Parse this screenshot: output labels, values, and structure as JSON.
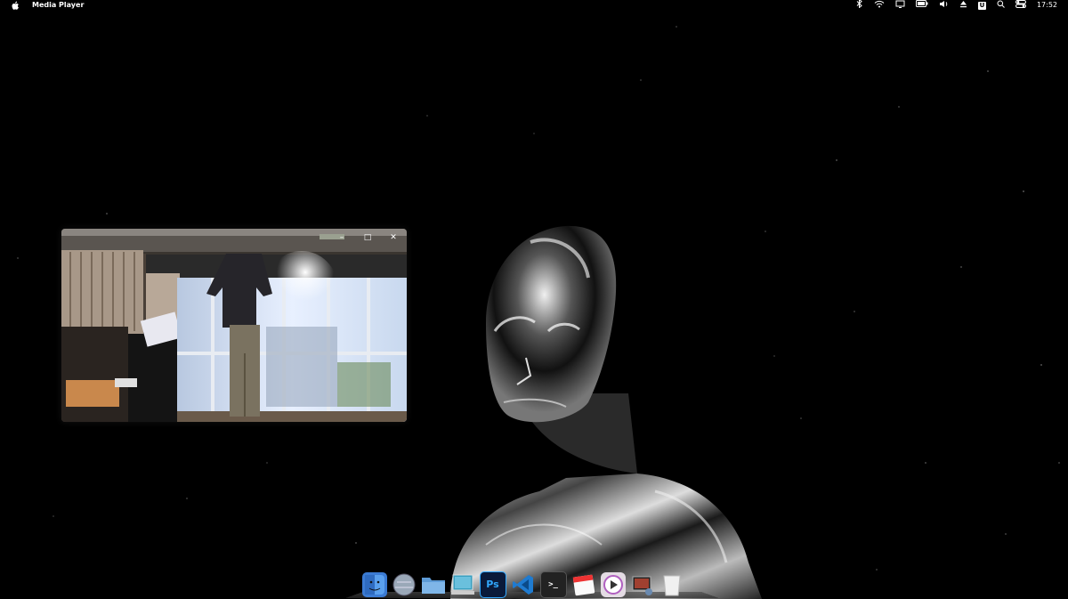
{
  "menubar": {
    "app_name": "Media Player",
    "clock": "17:52",
    "status_icons": [
      "bluetooth-icon",
      "wifi-icon",
      "display-icon",
      "battery-icon",
      "volume-icon",
      "eject-icon",
      "user-badge-icon",
      "search-icon",
      "control-center-icon"
    ],
    "user_badge": "U"
  },
  "player": {
    "controls": [
      "minimize",
      "maximize",
      "close"
    ],
    "min_glyph": "–",
    "max_glyph": "□",
    "close_glyph": "✕"
  },
  "dock": {
    "items": [
      {
        "name": "finder-icon",
        "label": "☺",
        "bg": "#3b7bd4"
      },
      {
        "name": "browser-globe-icon",
        "label": "◉",
        "bg": "#7f8fa0"
      },
      {
        "name": "folder-icon",
        "label": "",
        "bg": "#5d9bd6"
      },
      {
        "name": "preview-icon",
        "label": "",
        "bg": "#3a8fb0"
      },
      {
        "name": "photoshop-icon",
        "label": "Ps",
        "bg": "#0a1a3a"
      },
      {
        "name": "vscode-icon",
        "label": "⟨⟩",
        "bg": "#1f7bd0"
      },
      {
        "name": "terminal-icon",
        "label": ">_",
        "bg": "#222"
      },
      {
        "name": "calendar-icon",
        "label": "",
        "bg": "#f2f2f2"
      },
      {
        "name": "media-player-icon",
        "label": "▶",
        "bg": "#d8d0d8"
      },
      {
        "name": "photo-app-icon",
        "label": "",
        "bg": "#404040"
      },
      {
        "name": "trash-icon",
        "label": "",
        "bg": "#e8e8e8"
      }
    ],
    "colors": {
      "accent": "#1f7bd0"
    }
  }
}
